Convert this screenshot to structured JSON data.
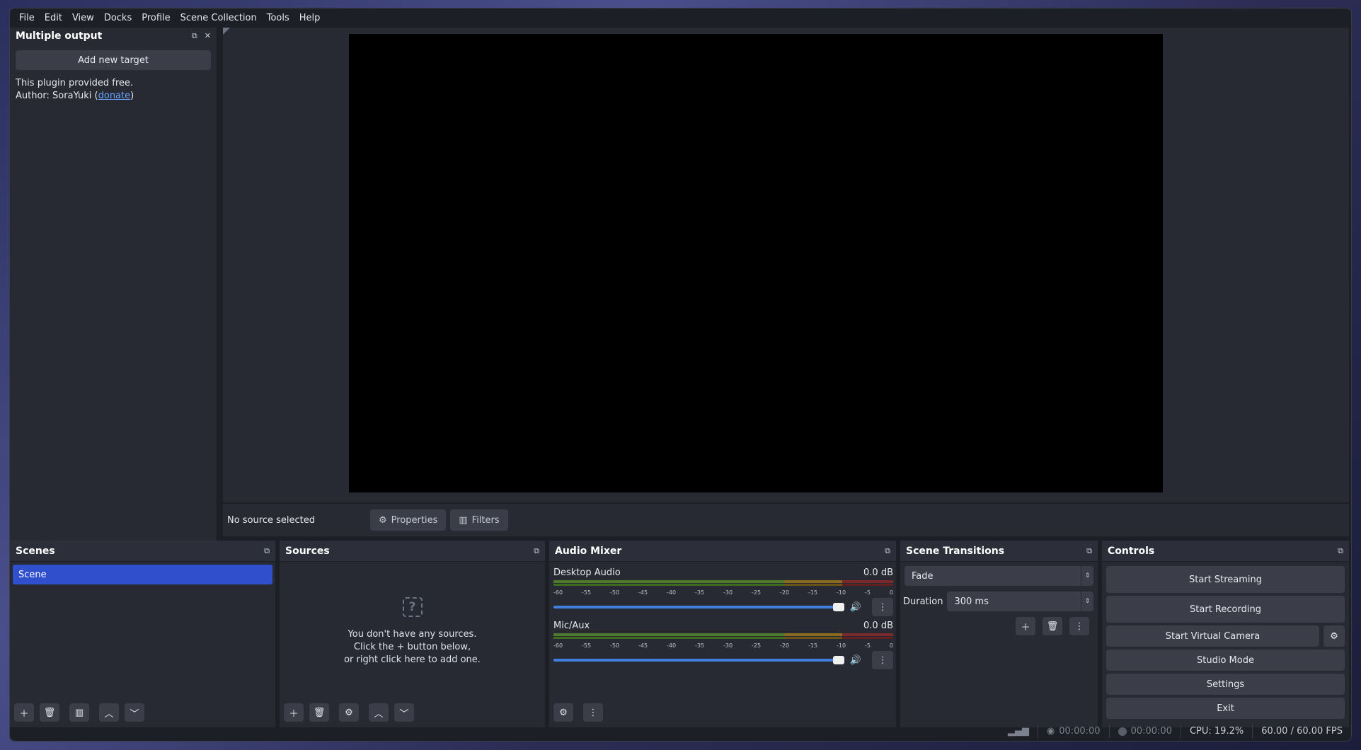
{
  "menu": [
    "File",
    "Edit",
    "View",
    "Docks",
    "Profile",
    "Scene Collection",
    "Tools",
    "Help"
  ],
  "left_dock": {
    "title": "Multiple output",
    "add_button": "Add new target",
    "line1": "This plugin provided free.",
    "author_prefix": "Author: SoraYuki (",
    "donate": "donate",
    "author_suffix": ")"
  },
  "source_bar": {
    "no_source": "No source selected",
    "properties": "Properties",
    "filters": "Filters"
  },
  "scenes": {
    "title": "Scenes",
    "items": [
      "Scene"
    ]
  },
  "sources": {
    "title": "Sources",
    "empty_line1": "You don't have any sources.",
    "empty_line2": "Click the + button below,",
    "empty_line3": "or right click here to add one."
  },
  "audio_mixer": {
    "title": "Audio Mixer",
    "ticks": [
      "-60",
      "-55",
      "-50",
      "-45",
      "-40",
      "-35",
      "-30",
      "-25",
      "-20",
      "-15",
      "-10",
      "-5",
      "0"
    ],
    "channels": [
      {
        "name": "Desktop Audio",
        "db": "0.0 dB",
        "volume": 1.0
      },
      {
        "name": "Mic/Aux",
        "db": "0.0 dB",
        "volume": 1.0
      }
    ]
  },
  "transitions": {
    "title": "Scene Transitions",
    "selected": "Fade",
    "duration_label": "Duration",
    "duration_value": "300 ms"
  },
  "controls": {
    "title": "Controls",
    "start_streaming": "Start Streaming",
    "start_recording": "Start Recording",
    "start_virtual_camera": "Start Virtual Camera",
    "studio_mode": "Studio Mode",
    "settings": "Settings",
    "exit": "Exit"
  },
  "status": {
    "stream_time": "00:00:00",
    "record_time": "00:00:00",
    "cpu": "CPU: 19.2%",
    "fps": "60.00 / 60.00 FPS"
  },
  "colors": {
    "accent": "#2f4fcc",
    "slider": "#3f7fe0",
    "panel": "#272a33",
    "background": "#1d1f26"
  }
}
